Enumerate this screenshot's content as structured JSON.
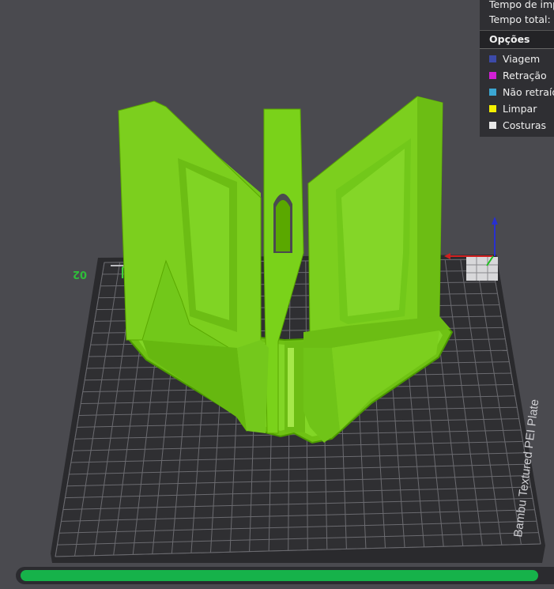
{
  "legend": {
    "time_rows": [
      "Tempo de imp",
      "Tempo total:"
    ],
    "section_title": "Opções",
    "items": [
      {
        "label": "Viagem",
        "color": "#3c4aa8"
      },
      {
        "label": "Retração",
        "color": "#d21fd6"
      },
      {
        "label": "Não retraíd",
        "color": "#3ba6d2"
      },
      {
        "label": "Limpar",
        "color": "#f5f000"
      },
      {
        "label": "Costuras",
        "color": "#e8e8e8"
      }
    ]
  },
  "plate": {
    "label": "Bambu Textured PEI Plate",
    "plate_number": "02"
  },
  "colors": {
    "background": "#4a4a4f",
    "bed": "#2d2d30",
    "grid": "#6a6a70",
    "model": "#7ad21a",
    "model_dark": "#5aa800",
    "progress": "#16b24a"
  },
  "progress": {
    "fraction": 0.97
  }
}
